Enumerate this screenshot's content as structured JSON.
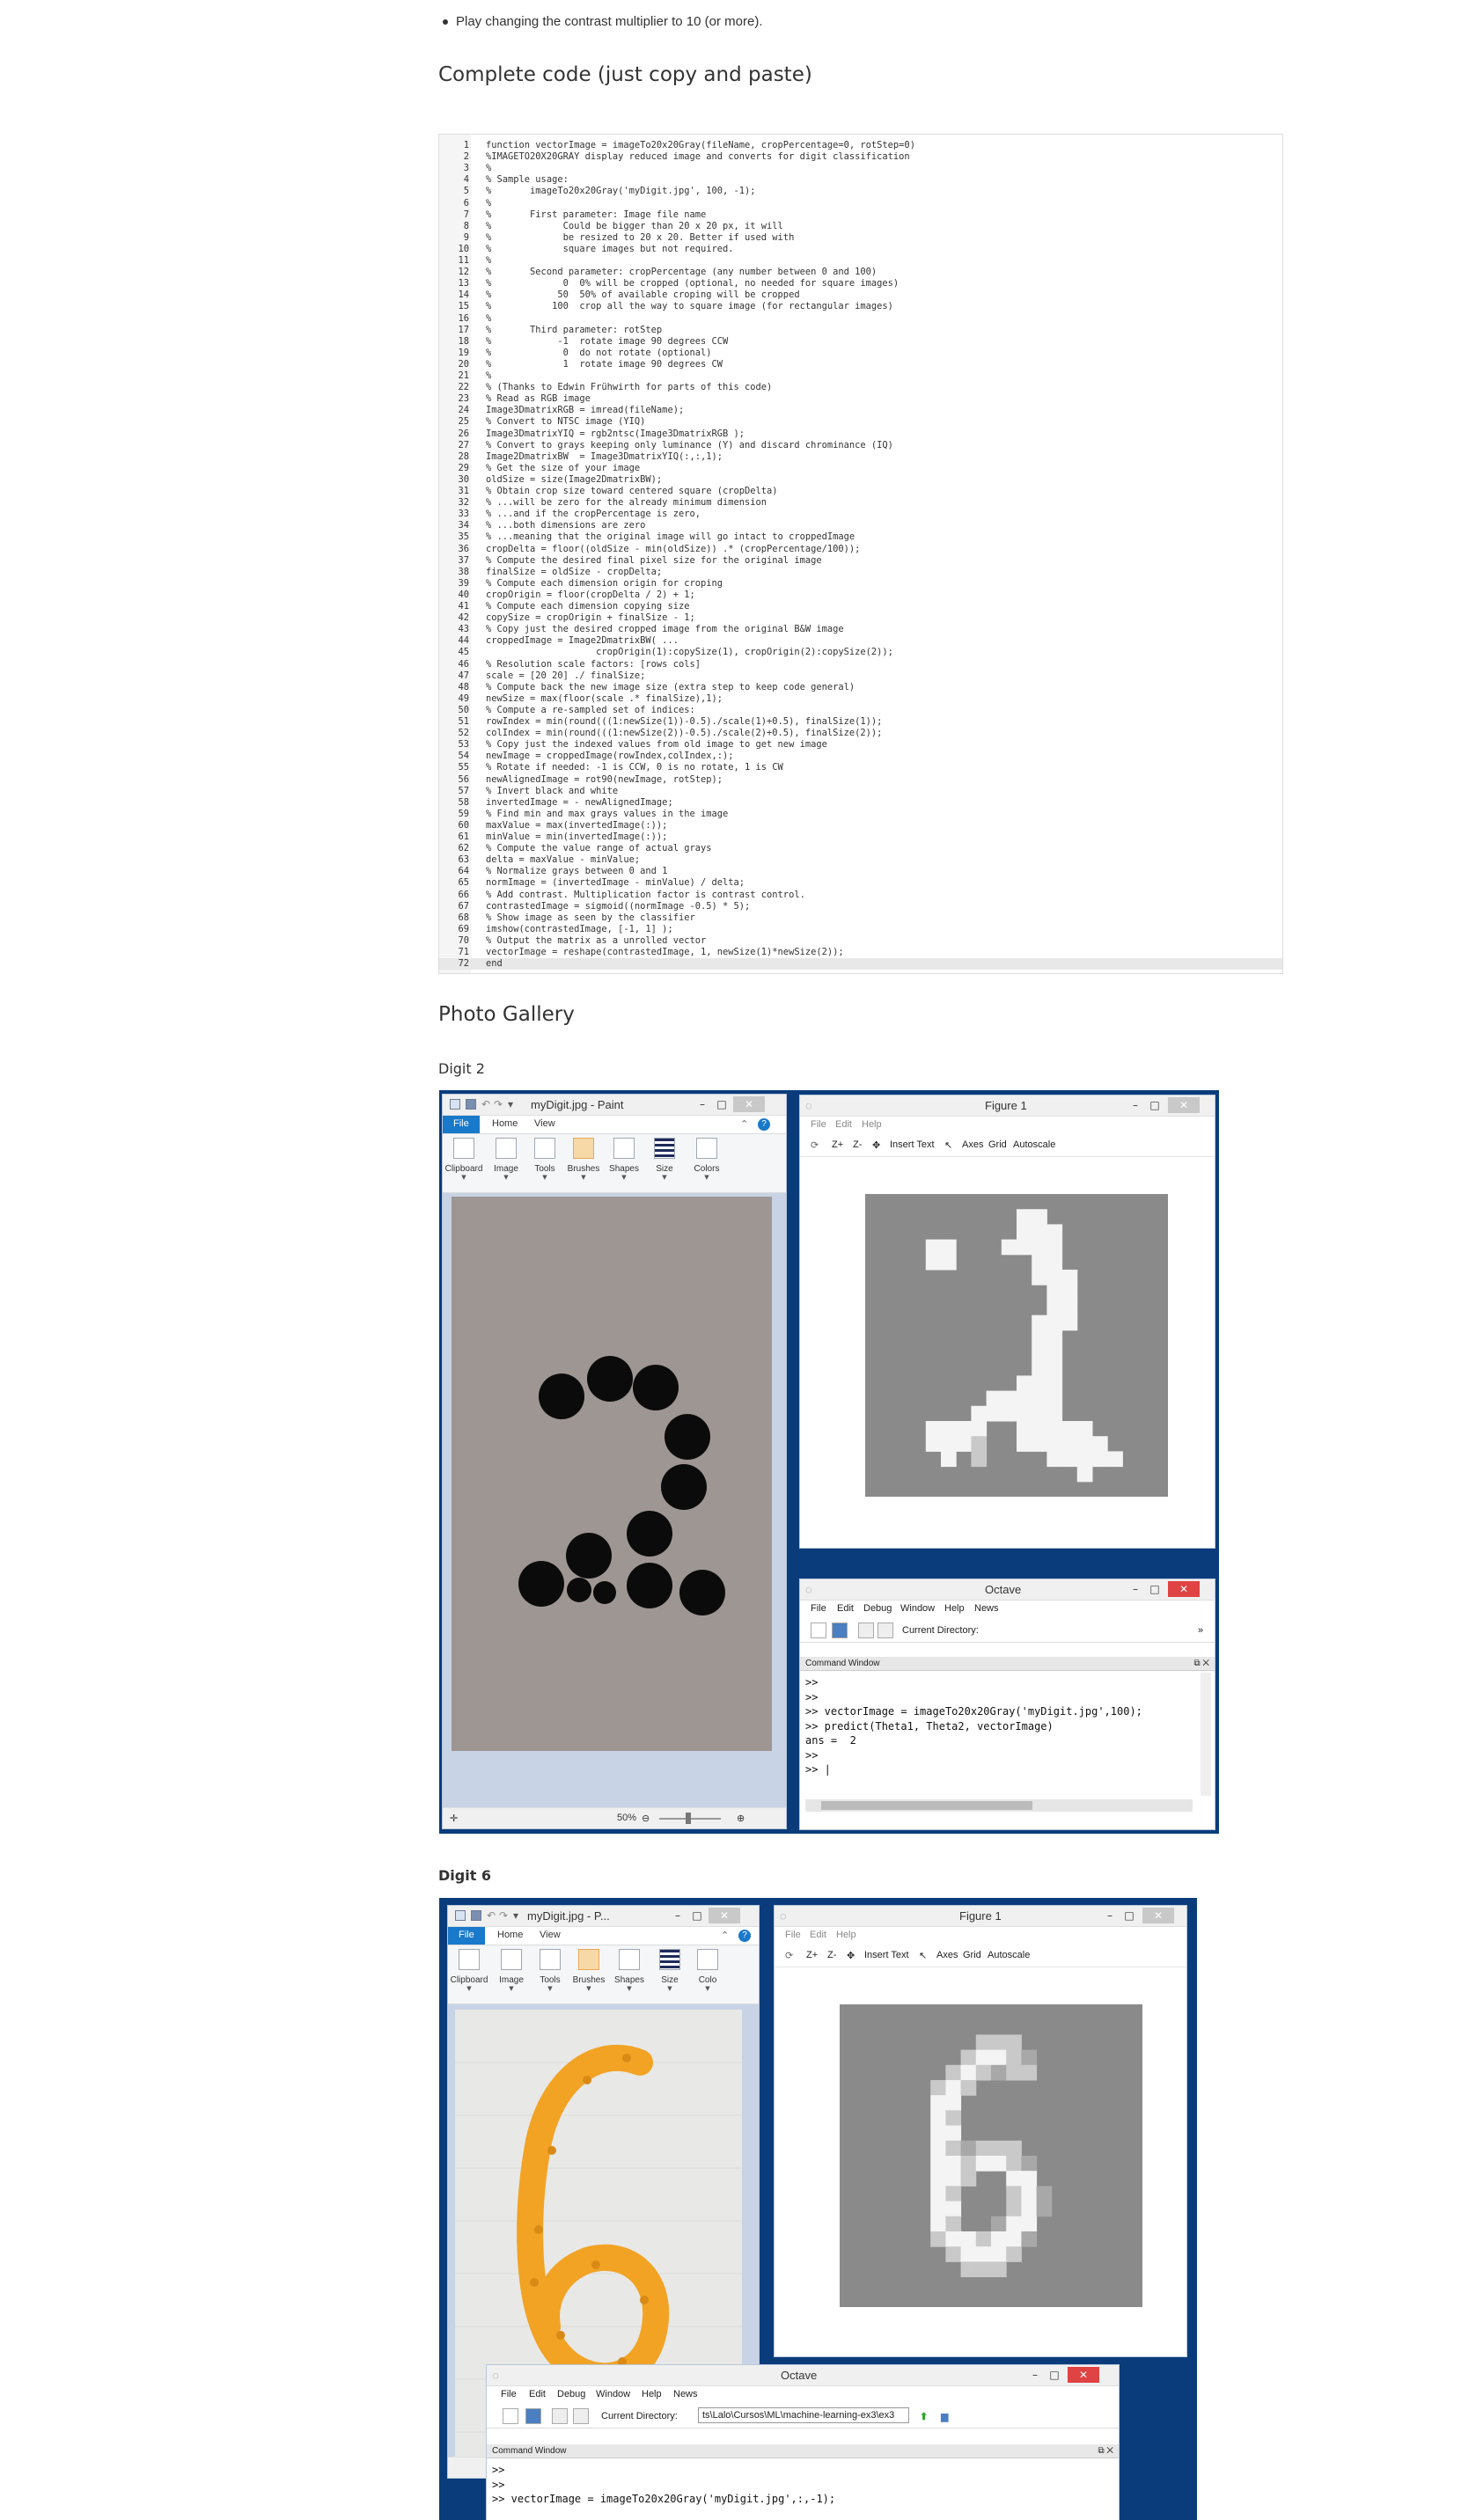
{
  "bullet_text": "Play changing the contrast multiplier to 10 (or more).",
  "code_section_title": "Complete code (just copy and paste)",
  "code_lines": [
    "function vectorImage = imageTo20x20Gray(fileName, cropPercentage=0, rotStep=0)",
    "%IMAGETO20X20GRAY display reduced image and converts for digit classification",
    "%",
    "% Sample usage:",
    "%       imageTo20x20Gray('myDigit.jpg', 100, -1);",
    "%",
    "%       First parameter: Image file name",
    "%             Could be bigger than 20 x 20 px, it will",
    "%             be resized to 20 x 20. Better if used with",
    "%             square images but not required.",
    "%",
    "%       Second parameter: cropPercentage (any number between 0 and 100)",
    "%             0  0% will be cropped (optional, no needed for square images)",
    "%            50  50% of available croping will be cropped",
    "%           100  crop all the way to square image (for rectangular images)",
    "%",
    "%       Third parameter: rotStep",
    "%            -1  rotate image 90 degrees CCW",
    "%             0  do not rotate (optional)",
    "%             1  rotate image 90 degrees CW",
    "%",
    "% (Thanks to Edwin Frühwirth for parts of this code)",
    "% Read as RGB image",
    "Image3DmatrixRGB = imread(fileName);",
    "% Convert to NTSC image (YIQ)",
    "Image3DmatrixYIQ = rgb2ntsc(Image3DmatrixRGB );",
    "% Convert to grays keeping only luminance (Y) and discard chrominance (IQ)",
    "Image2DmatrixBW  = Image3DmatrixYIQ(:,:,1);",
    "% Get the size of your image",
    "oldSize = size(Image2DmatrixBW);",
    "% Obtain crop size toward centered square (cropDelta)",
    "% ...will be zero for the already minimum dimension",
    "% ...and if the cropPercentage is zero,",
    "% ...both dimensions are zero",
    "% ...meaning that the original image will go intact to croppedImage",
    "cropDelta = floor((oldSize - min(oldSize)) .* (cropPercentage/100));",
    "% Compute the desired final pixel size for the original image",
    "finalSize = oldSize - cropDelta;",
    "% Compute each dimension origin for croping",
    "cropOrigin = floor(cropDelta / 2) + 1;",
    "% Compute each dimension copying size",
    "copySize = cropOrigin + finalSize - 1;",
    "% Copy just the desired cropped image from the original B&W image",
    "croppedImage = Image2DmatrixBW( ...",
    "                    cropOrigin(1):copySize(1), cropOrigin(2):copySize(2));",
    "% Resolution scale factors: [rows cols]",
    "scale = [20 20] ./ finalSize;",
    "% Compute back the new image size (extra step to keep code general)",
    "newSize = max(floor(scale .* finalSize),1);",
    "% Compute a re-sampled set of indices:",
    "rowIndex = min(round(((1:newSize(1))-0.5)./scale(1)+0.5), finalSize(1));",
    "colIndex = min(round(((1:newSize(2))-0.5)./scale(2)+0.5), finalSize(2));",
    "% Copy just the indexed values from old image to get new image",
    "newImage = croppedImage(rowIndex,colIndex,:);",
    "% Rotate if needed: -1 is CCW, 0 is no rotate, 1 is CW",
    "newAlignedImage = rot90(newImage, rotStep);",
    "% Invert black and white",
    "invertedImage = - newAlignedImage;",
    "% Find min and max grays values in the image",
    "maxValue = max(invertedImage(:));",
    "minValue = min(invertedImage(:));",
    "% Compute the value range of actual grays",
    "delta = maxValue - minValue;",
    "% Normalize grays between 0 and 1",
    "normImage = (invertedImage - minValue) / delta;",
    "% Add contrast. Multiplication factor is contrast control.",
    "contrastedImage = sigmoid((normImage -0.5) * 5);",
    "% Show image as seen by the classifier",
    "imshow(contrastedImage, [-1, 1] );",
    "% Output the matrix as a unrolled vector",
    "vectorImage = reshape(contrastedImage, 1, newSize(1)*newSize(2));",
    "end"
  ],
  "gallery_title": "Photo Gallery",
  "digit2_title": "Digit 2",
  "digit6_title": "Digit 6",
  "paint": {
    "title_full": "myDigit.jpg - Paint",
    "title_short": "myDigit.jpg - P...",
    "tabs": [
      "File",
      "Home",
      "View"
    ],
    "groups": [
      "Clipboard",
      "Image",
      "Tools",
      "Brushes",
      "Shapes",
      "Size",
      "Colors"
    ],
    "groups_short_last": "Colo",
    "zoom": "50%"
  },
  "figure": {
    "title": "Figure 1",
    "menu": [
      "File",
      "Edit",
      "Help"
    ],
    "toolbar": [
      "Z+",
      "Z-",
      "Insert Text",
      "Axes",
      "Grid",
      "Autoscale"
    ]
  },
  "octave": {
    "title": "Octave",
    "menu": [
      "File",
      "Edit",
      "Debug",
      "Window",
      "Help",
      "News"
    ],
    "current_dir_label": "Current Directory:",
    "current_dir_value": "ts\\Lalo\\Cursos\\ML\\machine-learning-ex3\\ex3",
    "command_window": "Command Window",
    "console_1": [
      ">>",
      ">>",
      ">> vectorImage = imageTo20x20Gray('myDigit.jpg',100);",
      ">> predict(Theta1, Theta2, vectorImage)",
      "ans =  2",
      ">>",
      ">> |"
    ],
    "console_2": [
      ">>",
      ">>",
      ">> vectorImage = imageTo20x20Gray('myDigit.jpg',:,-1);"
    ]
  },
  "colors": {
    "panel_blue": "#0a3c7c",
    "paint_file_tab": "#1979ca",
    "octave_close": "#e04343",
    "goldfish": "#f2a324"
  }
}
